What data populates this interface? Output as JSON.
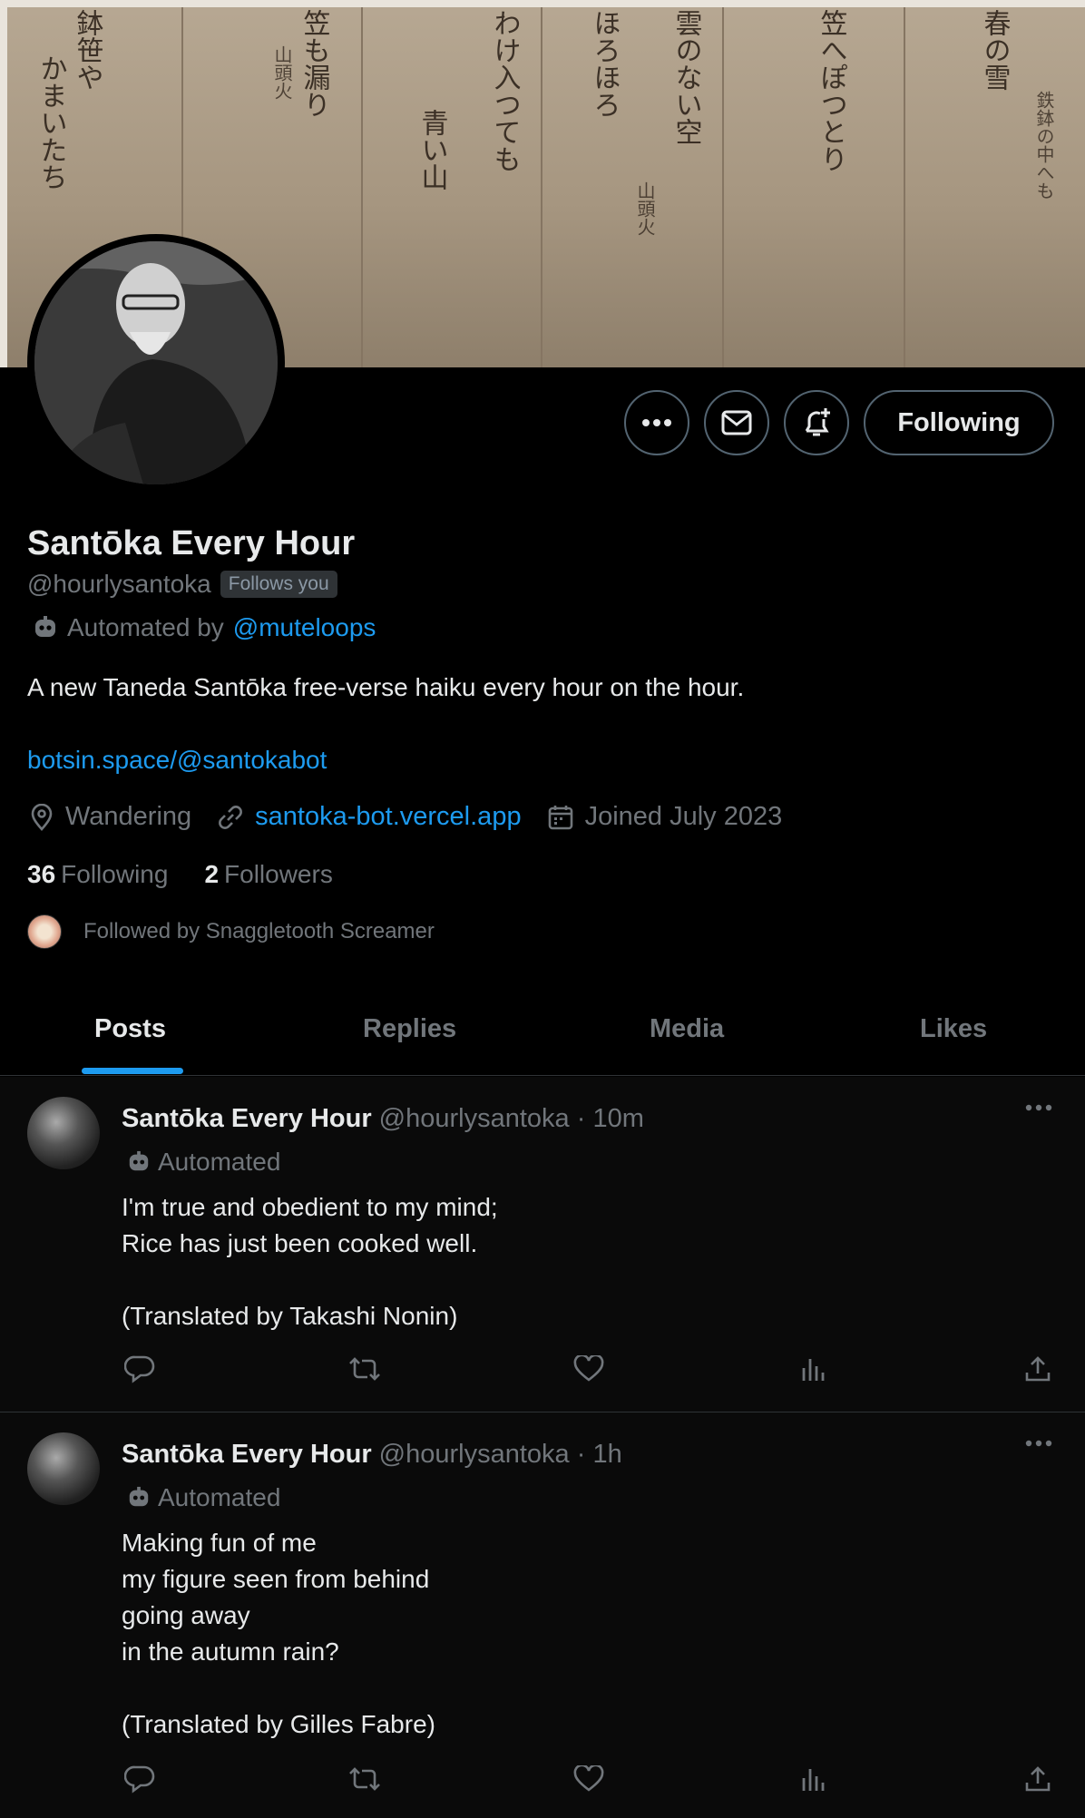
{
  "profile": {
    "name": "Santōka Every Hour",
    "handle": "@hourlysantoka",
    "follows_you": "Follows you",
    "automated_prefix": "Automated by",
    "automated_by": "@muteloops",
    "bio": "A new Taneda Santōka free-verse haiku every hour on the hour.",
    "bio_link": "botsin.space/@santokabot",
    "location": "Wandering",
    "website": "santoka-bot.vercel.app",
    "joined": "Joined July 2023",
    "following_count": "36",
    "following_label": "Following",
    "followers_count": "2",
    "followers_label": "Followers",
    "followed_by": "Followed by Snaggletooth Screamer"
  },
  "actions": {
    "follow_label": "Following",
    "icons": [
      "more-icon",
      "message-icon",
      "notify-icon"
    ]
  },
  "tabs": [
    "Posts",
    "Replies",
    "Media",
    "Likes"
  ],
  "active_tab": "Posts",
  "posts": [
    {
      "name": "Santōka Every Hour",
      "handle": "@hourlysantoka",
      "time": "10m",
      "automated": "Automated",
      "body": "I'm true and obedient to my mind;\nRice has just been cooked well.\n\n(Translated by Takashi Nonin)"
    },
    {
      "name": "Santōka Every Hour",
      "handle": "@hourlysantoka",
      "time": "1h",
      "automated": "Automated",
      "body": "Making fun of me\nmy figure seen from behind\ngoing away\nin the autumn rain?\n\n(Translated by Gilles Fabre)"
    }
  ],
  "colors": {
    "accent": "#1d9bf0",
    "background": "#000000",
    "muted": "#71767b",
    "text": "#e7e9ea",
    "border": "#2f3336"
  }
}
